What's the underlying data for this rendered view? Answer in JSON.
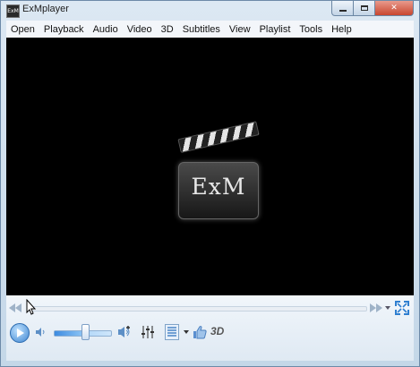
{
  "window": {
    "title": "ExMplayer",
    "app_icon_text": "ExM"
  },
  "title_buttons": [
    "minimize",
    "maximize",
    "close"
  ],
  "menu": [
    "Open",
    "Playback",
    "Audio",
    "Video",
    "3D",
    "Subtitles",
    "View",
    "Playlist",
    "Tools",
    "Help"
  ],
  "logo": {
    "text": "ExM"
  },
  "controls": {
    "label_3d": "3D",
    "seek_position": 0.0,
    "volume_level": 0.5
  },
  "colors": {
    "accent": "#3f86d1",
    "video_bg": "#000000",
    "chrome_bg": "#dfe9f3"
  }
}
